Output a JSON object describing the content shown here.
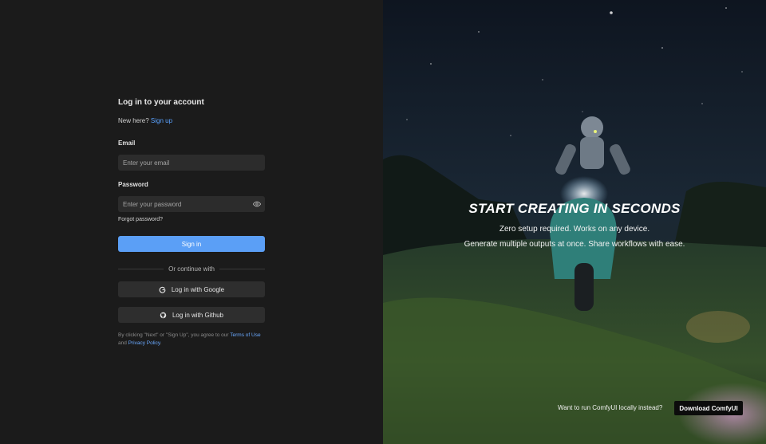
{
  "login": {
    "title": "Log in to your account",
    "new_here": "New here?",
    "sign_up": "Sign up",
    "email_label": "Email",
    "email_placeholder": "Enter your email",
    "password_label": "Password",
    "password_placeholder": "Enter your password",
    "forgot": "Forgot password?",
    "sign_in": "Sign in",
    "or_continue": "Or continue with",
    "google": "Log in with Google",
    "github": "Log in with Github",
    "terms_prefix": "By clicking \"Next\" or \"Sign Up\", you agree to our",
    "terms_link": "Terms of Use",
    "terms_and": "and",
    "privacy_link": "Privacy Policy",
    "terms_suffix": "."
  },
  "hero": {
    "title": "START CREATING IN SECONDS",
    "line1": "Zero setup required. Works on any device.",
    "line2": "Generate multiple outputs at once. Share workflows with ease."
  },
  "footer": {
    "local_text": "Want to run ComfyUI locally instead?",
    "download": "Download ComfyUI"
  },
  "icons": {
    "eye": "eye-icon",
    "google": "google-icon",
    "github": "github-icon"
  },
  "colors": {
    "accent": "#5b9ff6",
    "link": "#5aa2ff",
    "panel": "#1b1b1b"
  }
}
